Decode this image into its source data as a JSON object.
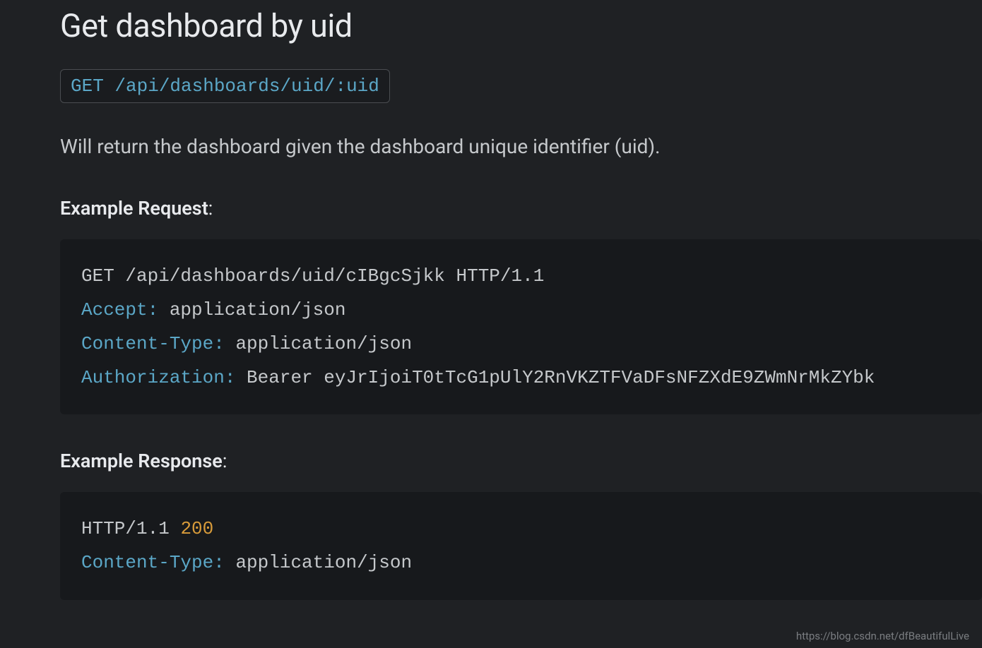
{
  "heading": "Get dashboard by uid",
  "endpoint": "GET /api/dashboards/uid/:uid",
  "description": "Will return the dashboard given the dashboard unique identifier (uid).",
  "request": {
    "label_strong": "Example Request",
    "label_suffix": ":",
    "line1": "GET /api/dashboards/uid/cIBgcSjkk HTTP/1.1",
    "accept_key": "Accept:",
    "accept_val": " application/json",
    "ctype_key": "Content-Type:",
    "ctype_val": " application/json",
    "auth_key": "Authorization:",
    "auth_val": " Bearer eyJrIjoiT0tTcG1pUlY2RnVKZTFVaDFsNFZXdE9ZWmNrMkZYbk"
  },
  "response": {
    "label_strong": "Example Response",
    "label_suffix": ":",
    "proto": "HTTP/1.1 ",
    "status": "200",
    "ctype_key": "Content-Type:",
    "ctype_val": " application/json"
  },
  "watermark": "https://blog.csdn.net/dfBeautifulLive"
}
